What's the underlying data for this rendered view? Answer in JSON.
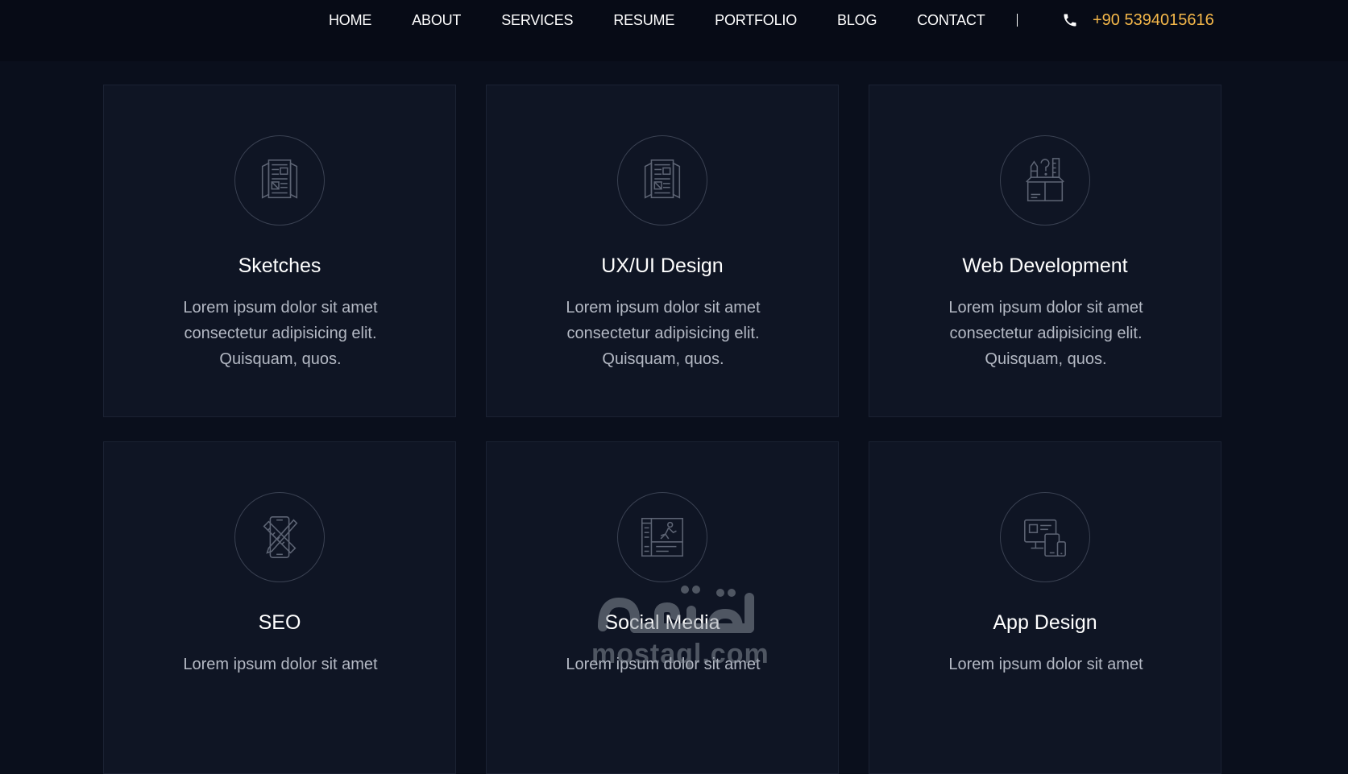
{
  "nav": {
    "items": [
      "HOME",
      "ABOUT",
      "SERVICES",
      "RESUME",
      "PORTFOLIO",
      "BLOG",
      "CONTACT"
    ],
    "phone": "+90 5394015616"
  },
  "services": [
    {
      "title": "Sketches",
      "line1": "Lorem ipsum dolor sit amet",
      "line2": "consectetur adipisicing elit.",
      "line3": "Quisquam, quos.",
      "icon": "blueprint-icon"
    },
    {
      "title": "UX/UI Design",
      "line1": "Lorem ipsum dolor sit amet",
      "line2": "consectetur adipisicing elit.",
      "line3": "Quisquam, quos.",
      "icon": "blueprint-icon"
    },
    {
      "title": "Web Development",
      "line1": "Lorem ipsum dolor sit amet",
      "line2": "consectetur adipisicing elit.",
      "line3": "Quisquam, quos.",
      "icon": "design-box-icon"
    },
    {
      "title": "SEO",
      "line1": "Lorem ipsum dolor sit amet",
      "icon": "ruler-pencil-phone-icon"
    },
    {
      "title": "Social Media",
      "line1": "Lorem ipsum dolor sit amet",
      "icon": "storyboard-icon"
    },
    {
      "title": "App Design",
      "line1": "Lorem ipsum dolor sit amet",
      "icon": "devices-icon"
    }
  ],
  "watermark": {
    "arabic": "مستقل",
    "latin": "mostaql.com"
  },
  "colors": {
    "background": "#0a0f1c",
    "card": "#0f1524",
    "accent": "#f5b84a",
    "text_muted": "#b4b9c4"
  }
}
